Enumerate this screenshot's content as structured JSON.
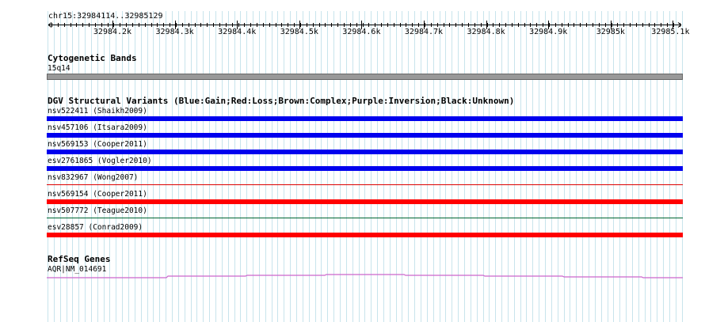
{
  "browser": {
    "locus": "chr15:32984114..32985129",
    "ruler_ticks": [
      "32984.2k",
      "32984.3k",
      "32984.4k",
      "32984.5k",
      "32984.6k",
      "32984.7k",
      "32984.8k",
      "32984.9k",
      "32985k",
      "32985.1k"
    ]
  },
  "tracks": {
    "cytoband": {
      "title": "Cytogenetic Bands",
      "band": "15q14",
      "color": "#999999"
    },
    "dgv": {
      "title": "DGV Structural Variants (Blue:Gain;Red:Loss;Brown:Complex;Purple:Inversion;Black:Unknown)",
      "features": [
        {
          "label": "nsv522411 (Shaikh2009)",
          "type": "gain",
          "color": "#0000ee",
          "style": "thick"
        },
        {
          "label": "nsv457106 (Itsara2009)",
          "type": "gain",
          "color": "#0000ee",
          "style": "thick"
        },
        {
          "label": "nsv569153 (Cooper2011)",
          "type": "gain",
          "color": "#0000ee",
          "style": "thick"
        },
        {
          "label": "esv2761865 (Vogler2010)",
          "type": "gain",
          "color": "#0000ee",
          "style": "thick"
        },
        {
          "label": "nsv832967 (Wong2007)",
          "type": "loss",
          "color": "#dd0000",
          "style": "thin"
        },
        {
          "label": "nsv569154 (Cooper2011)",
          "type": "loss",
          "color": "#ff0000",
          "style": "thick"
        },
        {
          "label": "nsv507772 (Teague2010)",
          "type": "unknown",
          "color": "#006633",
          "style": "thin"
        },
        {
          "label": "esv28857 (Conrad2009)",
          "type": "loss",
          "color": "#ff0000",
          "style": "thick"
        }
      ]
    },
    "refseq": {
      "title": "RefSeq Genes",
      "gene": "AQR|NM_014691",
      "color": "#cc66cc"
    }
  }
}
